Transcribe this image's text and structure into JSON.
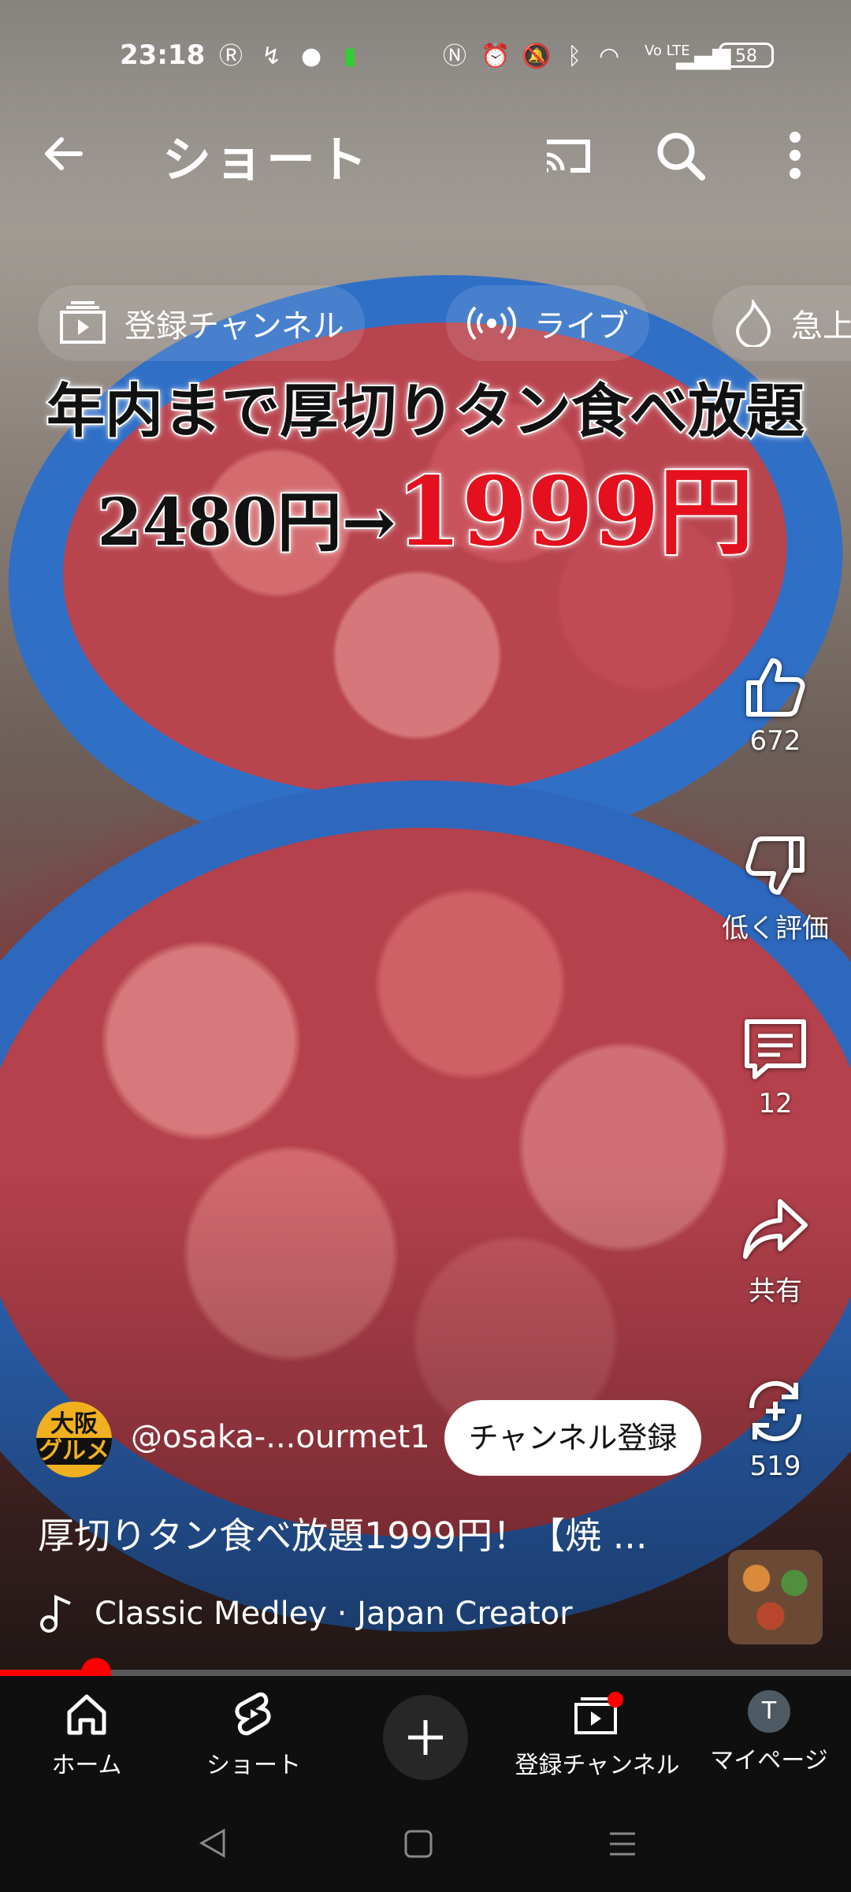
{
  "status_bar": {
    "time": "23:18",
    "battery": "58",
    "volte": "Vo LTE"
  },
  "header": {
    "title": "ショート"
  },
  "chips": [
    {
      "label": "登録チャンネル"
    },
    {
      "label": "ライブ"
    },
    {
      "label": "急上"
    }
  ],
  "overlay": {
    "line1": "年内まで厚切りタン食べ放題",
    "old_price": "2480円→",
    "new_price": "1999円"
  },
  "actions": {
    "like_count": "672",
    "dislike_label": "低く評価",
    "comment_count": "12",
    "share_label": "共有",
    "remix_count": "519"
  },
  "channel": {
    "avatar_line1": "大阪",
    "avatar_line2": "グルメ",
    "handle": "@osaka-...ourmet1",
    "subscribe_label": "チャンネル登録"
  },
  "video": {
    "title": "厚切りタン食べ放題1999円！【焼 ...",
    "music": "Classic Medley · Japan Creator",
    "progress": 0.113
  },
  "nav": {
    "home": "ホーム",
    "shorts": "ショート",
    "subscriptions": "登録チャンネル",
    "mypage": "マイページ",
    "avatar_initial": "T"
  },
  "colors": {
    "accent": "#ff0000",
    "price_red": "#e4101e",
    "nav_bg": "#0f0f0f"
  }
}
